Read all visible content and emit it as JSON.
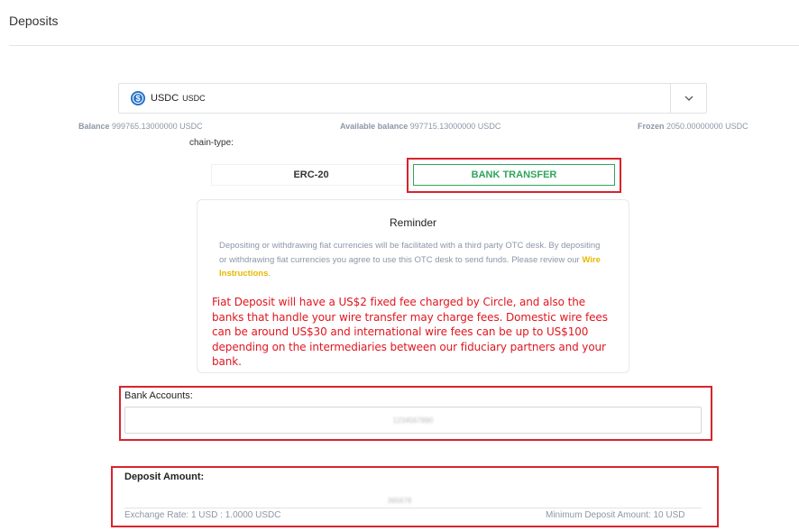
{
  "page": {
    "title": "Deposits"
  },
  "currency": {
    "icon": "usdc-coin-icon",
    "name": "USDC",
    "code": "USDC"
  },
  "balances": {
    "balance_label": "Balance",
    "balance_value": "999765.13000000 USDC",
    "available_label": "Available balance",
    "available_value": "997715.13000000 USDC",
    "frozen_label": "Frozen",
    "frozen_value": "2050.00000000 USDC"
  },
  "chain": {
    "label": "chain-type:",
    "tabs": [
      {
        "label": "ERC-20",
        "selected": false
      },
      {
        "label": "BANK TRANSFER",
        "selected": true
      }
    ]
  },
  "reminder": {
    "title": "Reminder",
    "text": "Depositing or withdrawing fiat currencies will be facilitated with a third party OTC desk. By depositing or withdrawing fiat currencies you agree to use this OTC desk to send funds. Please review our",
    "link": "Wire Instructions",
    "link_suffix": ".",
    "fee_notice": "Fiat Deposit will have a US$2 fixed fee charged by Circle, and also the banks that handle your wire transfer may charge fees. Domestic wire fees can be around US$30 and international wire fees can be up to US$100 depending on the intermediaries between our fiduciary partners and your bank."
  },
  "bank_accounts": {
    "label": "Bank Accounts:",
    "selected": "1234567890"
  },
  "deposit": {
    "label": "Deposit Amount:",
    "value": "365678",
    "exchange_rate_label": "Exchange Rate:",
    "exchange_rate_value": "1 USD : 1.0000 USDC",
    "minimum_label": "Minimum Deposit Amount:",
    "minimum_value": "10 USD"
  },
  "colors": {
    "accent_green": "#2fa55b",
    "highlight_red": "#d9232d",
    "notice_red": "#e0161f",
    "link_yellow": "#e6b800",
    "usdc_blue": "#2775ca"
  }
}
